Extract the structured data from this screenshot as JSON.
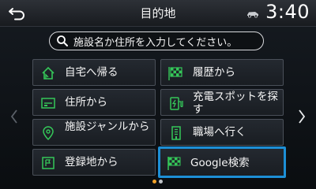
{
  "header": {
    "title": "目的地",
    "time": "3:40",
    "back_icon": "back-arrow-icon",
    "car_icon": "car-icon"
  },
  "search": {
    "placeholder": "施設名か住所を入力してください。",
    "icon": "search-icon"
  },
  "menu": {
    "home": "自宅へ帰る",
    "history": "履歴から",
    "address": "住所から",
    "charging": "充電スポットを探す",
    "category": "施設ジャンルから",
    "work": "職場へ行く",
    "registered": "登録地から",
    "google": "Google検索"
  },
  "pager": {
    "current": 1,
    "total": 2
  },
  "colors": {
    "accent_green": "#35c759",
    "highlight_blue": "#1d8fd6",
    "page_dot_active": "#f0a12a"
  }
}
